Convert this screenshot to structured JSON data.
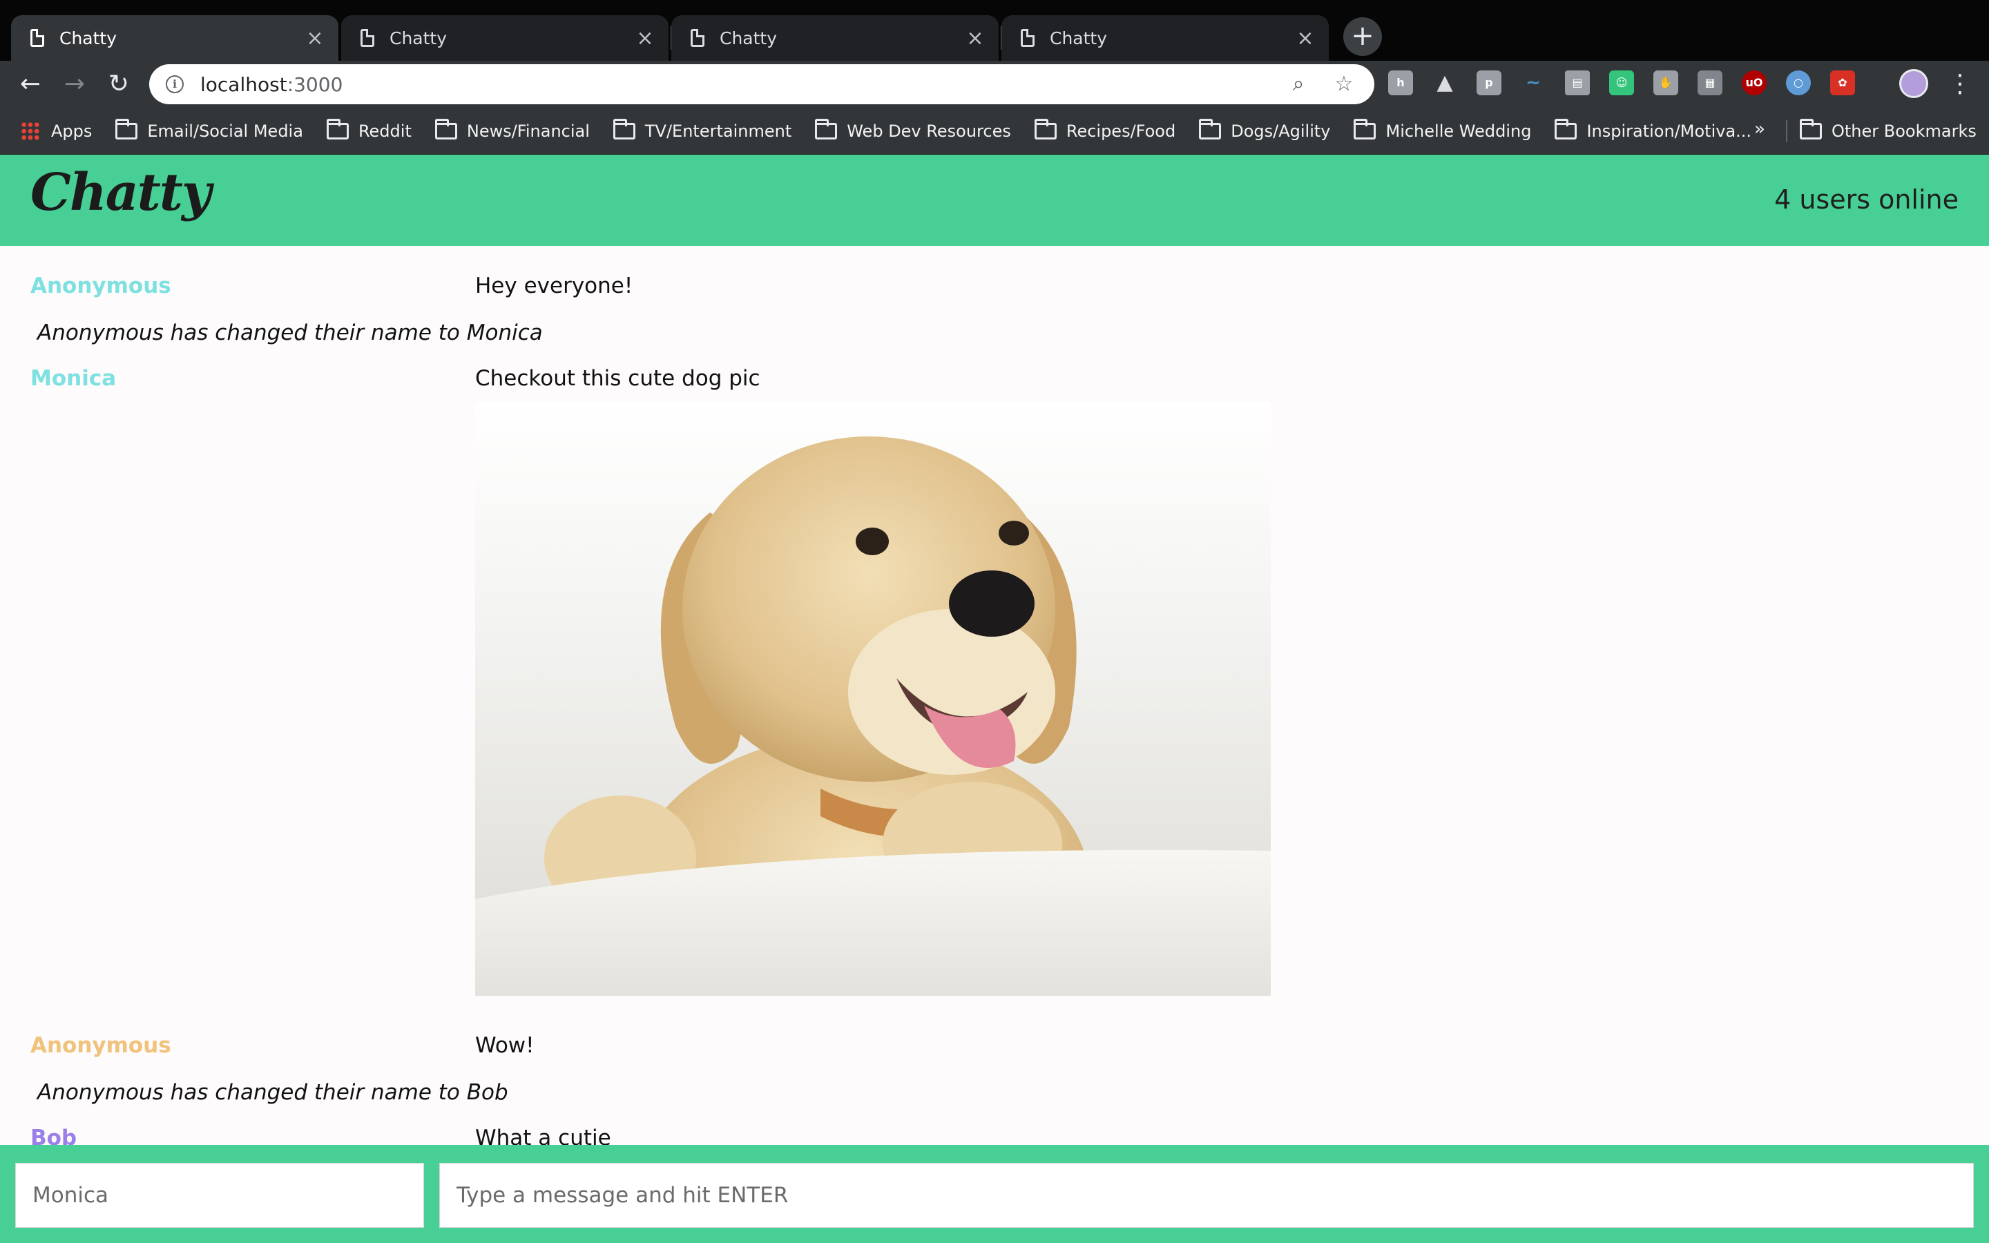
{
  "browser": {
    "tabs": [
      {
        "title": "Chatty",
        "active": true
      },
      {
        "title": "Chatty",
        "active": false
      },
      {
        "title": "Chatty",
        "active": false
      },
      {
        "title": "Chatty",
        "active": false
      }
    ],
    "url_host": "localhost",
    "url_port": ":3000",
    "bookmarks": [
      "Email/Social Media",
      "Reddit",
      "News/Financial",
      "TV/Entertainment",
      "Web Dev Resources",
      "Recipes/Food",
      "Dogs/Agility",
      "Michelle Wedding",
      "Inspiration/Motiva..."
    ],
    "apps_label": "Apps",
    "more_bookmarks": "»",
    "other_bookmarks": "Other Bookmarks",
    "icons": {
      "back": "arrow-left-icon",
      "forward": "arrow-right-icon",
      "reload": "reload-icon",
      "zoom": "zoom-icon",
      "star": "star-icon",
      "menu": "kebab-menu-icon"
    }
  },
  "app": {
    "logo": "Chatty",
    "users_online": "4 users online",
    "colors": {
      "accent": "#48cf95",
      "user_anonymous_1": "#7ee0e0",
      "user_monica": "#7ee0e0",
      "user_anonymous_2": "#f0c27b",
      "user_bob": "#9a7fe8"
    },
    "messages": [
      {
        "type": "message",
        "username": "Anonymous",
        "content": "Hey everyone!"
      },
      {
        "type": "notification",
        "content": "Anonymous has changed their name to Monica"
      },
      {
        "type": "message",
        "username": "Monica",
        "content": "Checkout this cute dog pic",
        "image": "golden-retriever-puppy"
      },
      {
        "type": "message",
        "username": "Anonymous",
        "content": "Wow!"
      },
      {
        "type": "notification",
        "content": "Anonymous has changed their name to Bob"
      },
      {
        "type": "message",
        "username": "Bob",
        "content": "What a cutie"
      }
    ],
    "compose": {
      "username_placeholder": "Monica",
      "message_placeholder": "Type a message and hit ENTER"
    }
  }
}
